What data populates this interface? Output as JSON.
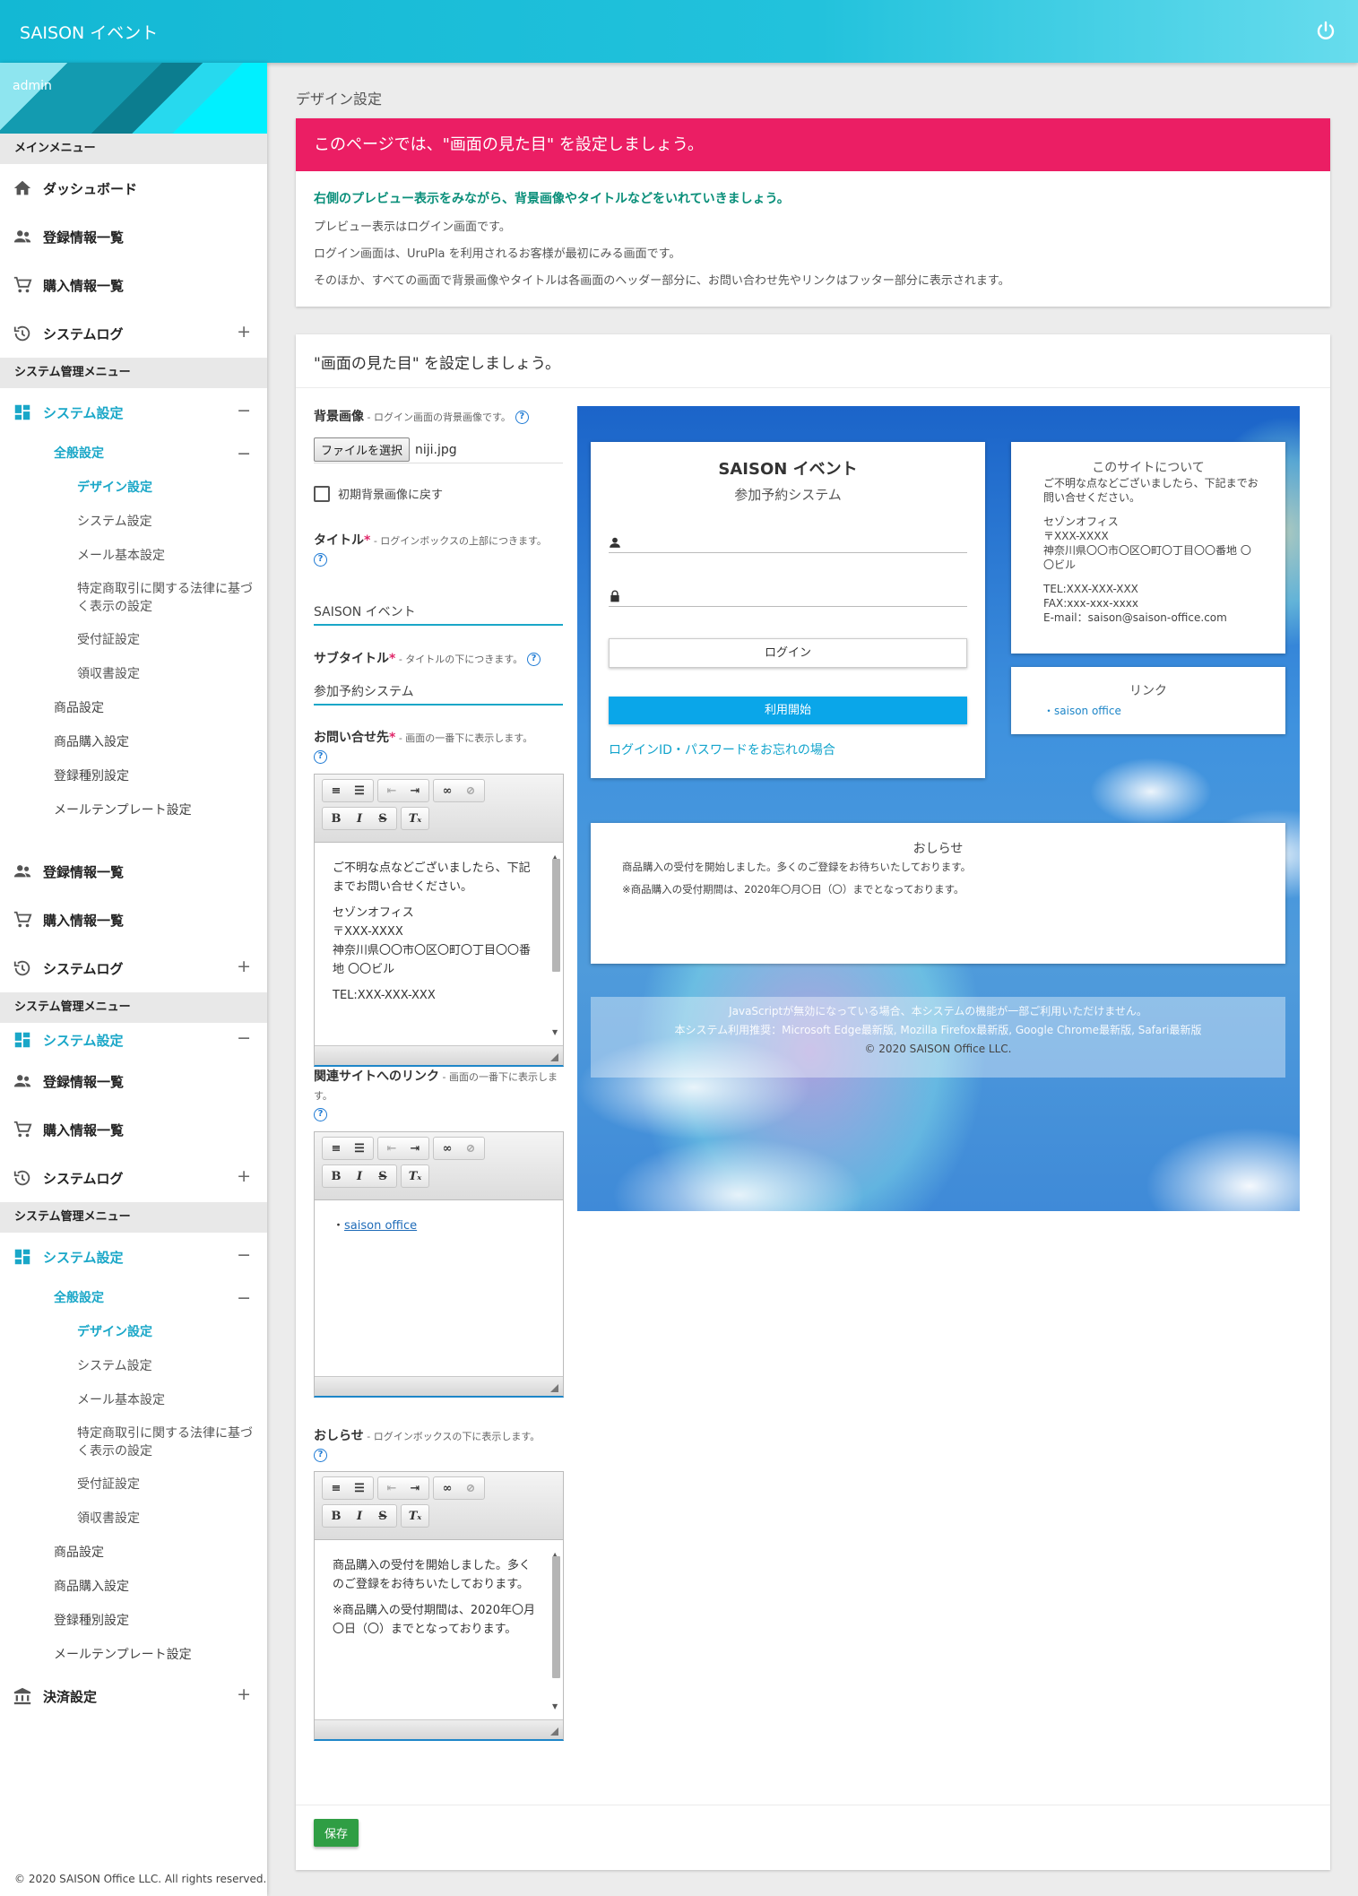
{
  "header": {
    "app_title": "SAISON イベント"
  },
  "sidebar": {
    "user": "admin",
    "main_menu": "メインメニュー",
    "sys_menu": "システム管理メニュー",
    "dashboard": "ダッシュボード",
    "registrations": "登録情報一覧",
    "purchases": "購入情報一覧",
    "system_log": "システムログ",
    "system_settings": "システム設定",
    "general": "全般設定",
    "design": "デザイン設定",
    "system": "システム設定",
    "mail_basic": "メール基本設定",
    "tokusho": "特定商取引に関する法律に基づく表示の設定",
    "receipt_cert": "受付証設定",
    "receipt": "領収書設定",
    "product": "商品設定",
    "product_purchase": "商品購入設定",
    "reg_type": "登録種別設定",
    "mail_template": "メールテンプレート設定",
    "payment": "決済設定",
    "plus": "+",
    "minus": "−",
    "footer": "© 2020 SAISON Office LLC. All rights reserved."
  },
  "breadcrumb": "デザイン設定",
  "notice": {
    "heading": "このページでは、\"画面の見た目\" を設定しましょう。",
    "lead": "右側のプレビュー表示をみながら、背景画像やタイトルなどをいれていきましょう。",
    "line1": "プレビュー表示はログイン画面です。",
    "line2": "ログイン画面は、UruPla を利用されるお客様が最初にみる画面です。",
    "line3": "そのほか、すべての画面で背景画像やタイトルは各画面のヘッダー部分に、お問い合わせ先やリンクはフッター部分に表示されます。"
  },
  "form": {
    "panel_title": "\"画面の見た目\" を設定しましょう。",
    "help": "?",
    "required": "*",
    "bg_label": "背景画像",
    "bg_hint": " - ログイン画面の背景画像です。",
    "file_button": "ファイルを選択",
    "file_name": "niji.jpg",
    "reset_bg": "初期背景画像に戻す",
    "title_label": "タイトル",
    "title_hint": " - ログインボックスの上部につきます。",
    "title_value": "SAISON イベント",
    "subtitle_label": "サブタイトル",
    "subtitle_hint": " - タイトルの下につきます。",
    "subtitle_value": "参加予約システム",
    "contact_label": "お問い合せ先",
    "contact_hint": " - 画面の一番下に表示します。",
    "contact_p1": "ご不明な点などございましたら、下記までお問い合せください。",
    "contact_p2_l1": "セゾンオフィス",
    "contact_p2_l2": "〒XXX-XXXX",
    "contact_p2_l3": "神奈川県〇〇市〇区〇町〇丁目〇〇番地 〇〇ビル",
    "contact_p3": "TEL:XXX-XXX-XXX",
    "links_label": "関連サイトへのリンク",
    "links_hint": " - 画面の一番下に表示します。",
    "links_bullet": "・",
    "links_item": "saison office",
    "news_label": "おしらせ",
    "news_hint": " - ログインボックスの下に表示します。",
    "news_p1": "商品購入の受付を開始しました。多くのご登録をお待ちいたしております。",
    "news_p2": "※商品購入の受付期間は、2020年〇月〇日（〇）までとなっております。",
    "save": "保存"
  },
  "preview": {
    "title": "SAISON イベント",
    "subtitle": "参加予約システム",
    "login_button": "ログイン",
    "start_button": "利用開始",
    "forgot": "ログインID・パスワードをお忘れの場合",
    "about_title": "このサイトについて",
    "about_p1": "ご不明な点などございましたら、下記までお問い合せください。",
    "about_l1": "セゾンオフィス",
    "about_l2": "〒XXX-XXXX",
    "about_l3": "神奈川県〇〇市〇区〇町〇丁目〇〇番地 〇〇ビル",
    "about_tel": "TEL:XXX-XXX-XXX",
    "about_fax": "FAX:xxx-xxx-xxxx",
    "about_email": "E-mail：saison@saison-office.com",
    "links_title": "リンク",
    "links_item": "・saison office",
    "news_title": "おしらせ",
    "news_p1": "商品購入の受付を開始しました。多くのご登録をお待ちいたしております。",
    "news_p2": "※商品購入の受付期間は、2020年〇月〇日（〇）までとなっております。",
    "footer_l1": "JavaScriptが無効になっている場合、本システムの機能が一部ご利用いただけません。",
    "footer_l2": "本システム利用推奨：Microsoft Edge最新版, Mozilla Firefox最新版, Google Chrome最新版, Safari最新版",
    "footer_copy": "© 2020 SAISON Office LLC."
  },
  "colors": {
    "accent": "#1aa7c8",
    "notice": "#eb1e64",
    "save": "#2f9e44",
    "header": "#13b8d4"
  }
}
